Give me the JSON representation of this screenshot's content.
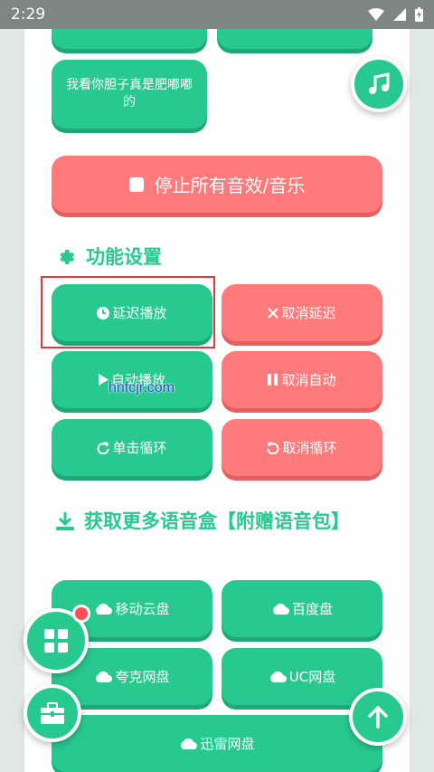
{
  "status": {
    "time": "2:29"
  },
  "top_button": {
    "label": "我看你胆子真是肥嘟嘟的"
  },
  "stop_button": {
    "label": "停止所有音效/音乐"
  },
  "settings": {
    "title": "功能设置",
    "buttons": [
      {
        "label": "延迟播放",
        "icon": "clock-icon"
      },
      {
        "label": "取消延迟",
        "icon": "close-icon"
      },
      {
        "label": "自动播放",
        "icon": "play-icon"
      },
      {
        "label": "取消自动",
        "icon": "pause-icon"
      },
      {
        "label": "单击循环",
        "icon": "redo-icon"
      },
      {
        "label": "取消循环",
        "icon": "undo-icon"
      }
    ]
  },
  "download": {
    "title": "获取更多语音盒【附赠语音包】",
    "buttons": [
      {
        "label": "移动云盘",
        "icon": "cloud-icon"
      },
      {
        "label": "百度盘",
        "icon": "cloud-icon"
      },
      {
        "label": "夸克网盘",
        "icon": "cloud-icon"
      },
      {
        "label": "UC网盘",
        "icon": "cloud-icon"
      },
      {
        "label": "迅雷网盘",
        "icon": "cloud-icon"
      }
    ]
  },
  "watermark": "hnfcjr.com",
  "colors": {
    "accent": "#28c98e",
    "danger": "#ff7b7b",
    "marker": "#e03a3a"
  }
}
